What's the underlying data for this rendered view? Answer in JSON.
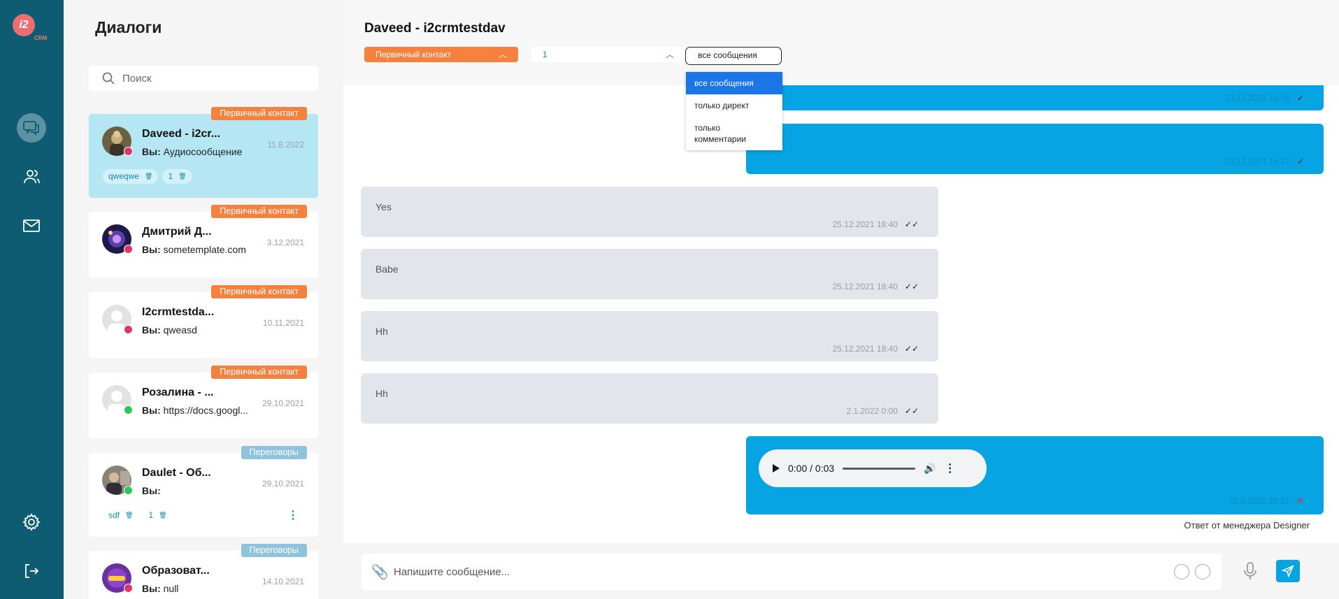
{
  "app": {
    "logo_text": "i2",
    "logo_sub": "CRM",
    "accent": "#07a4e3",
    "rail_color": "#0e5c72"
  },
  "rail": {
    "items": [
      {
        "name": "chat-icon",
        "active": true
      },
      {
        "name": "contacts-icon",
        "active": false
      },
      {
        "name": "mail-icon",
        "active": false
      },
      {
        "name": "gear-icon",
        "active": false
      },
      {
        "name": "logout-icon",
        "active": false
      }
    ]
  },
  "dialogs": {
    "title": "Диалоги",
    "search_placeholder": "Поиск",
    "items": [
      {
        "tag": "Первичный контакт",
        "tag_color": "#f5813e",
        "name": "Daveed - i2cr...",
        "prefix": "Вы:",
        "last": "Аудиосообщение",
        "date": "11.8.2022",
        "network": "instagram",
        "chips": [
          "qweqwe",
          "1"
        ]
      },
      {
        "tag": "Первичный контакт",
        "tag_color": "#f5813e",
        "name": "Дмитрий Д...",
        "prefix": "Вы:",
        "last": "sometemplate.com",
        "date": "3.12.2021",
        "network": "instagram",
        "chips": []
      },
      {
        "tag": "Первичный контакт",
        "tag_color": "#f5813e",
        "name": "I2crmtestda...",
        "prefix": "Вы:",
        "last": "qweasd",
        "date": "10.11.2021",
        "network": "instagram",
        "chips": []
      },
      {
        "tag": "Первичный контакт",
        "tag_color": "#f5813e",
        "name": "Розалина - ...",
        "prefix": "Вы:",
        "last": "https://docs.googl...",
        "date": "29.10.2021",
        "network": "whatsapp",
        "chips": []
      },
      {
        "tag": "Переговоры",
        "tag_color": "#8fc3dc",
        "name": "Daulet - Об...",
        "prefix": "Вы:",
        "last": "",
        "date": "29.10.2021",
        "network": "whatsapp",
        "chips": [
          "sdf",
          "1"
        ]
      },
      {
        "tag": "Переговоры",
        "tag_color": "#8fc3dc",
        "name": "Образоват...",
        "prefix": "Вы:",
        "last": "null",
        "date": "14.10.2021",
        "network": "instagram",
        "chips": []
      }
    ]
  },
  "chat": {
    "title": "Daveed - i2crmtestdav",
    "stage": "Первичный контакт",
    "number": "1",
    "filter": "все сообщения",
    "filter_options": [
      "все сообщения",
      "только директ",
      "только комментарии"
    ],
    "messages": [
      {
        "dir": "out",
        "text": "",
        "time": "23.12.2021 15:16",
        "status": "sent"
      },
      {
        "dir": "out",
        "text": "?",
        "time": "23.12.2021 15:17",
        "status": "sent"
      },
      {
        "dir": "in",
        "text": "Yes",
        "time": "25.12.2021 18:40",
        "status": "read"
      },
      {
        "dir": "in",
        "text": "Babe",
        "time": "25.12.2021 18:40",
        "status": "read"
      },
      {
        "dir": "in",
        "text": "Hh",
        "time": "25.12.2021 18:40",
        "status": "read"
      },
      {
        "dir": "in",
        "text": "Hh",
        "time": "2.1.2022 0:00",
        "status": "read"
      },
      {
        "dir": "out",
        "type": "audio",
        "audio_time": "0:00 / 0:03",
        "time": "11.8.2022 20:01",
        "status": "failed"
      }
    ],
    "manager_note": "Ответ от менеджера Designer",
    "composer_placeholder": "Напишите сообщение..."
  }
}
